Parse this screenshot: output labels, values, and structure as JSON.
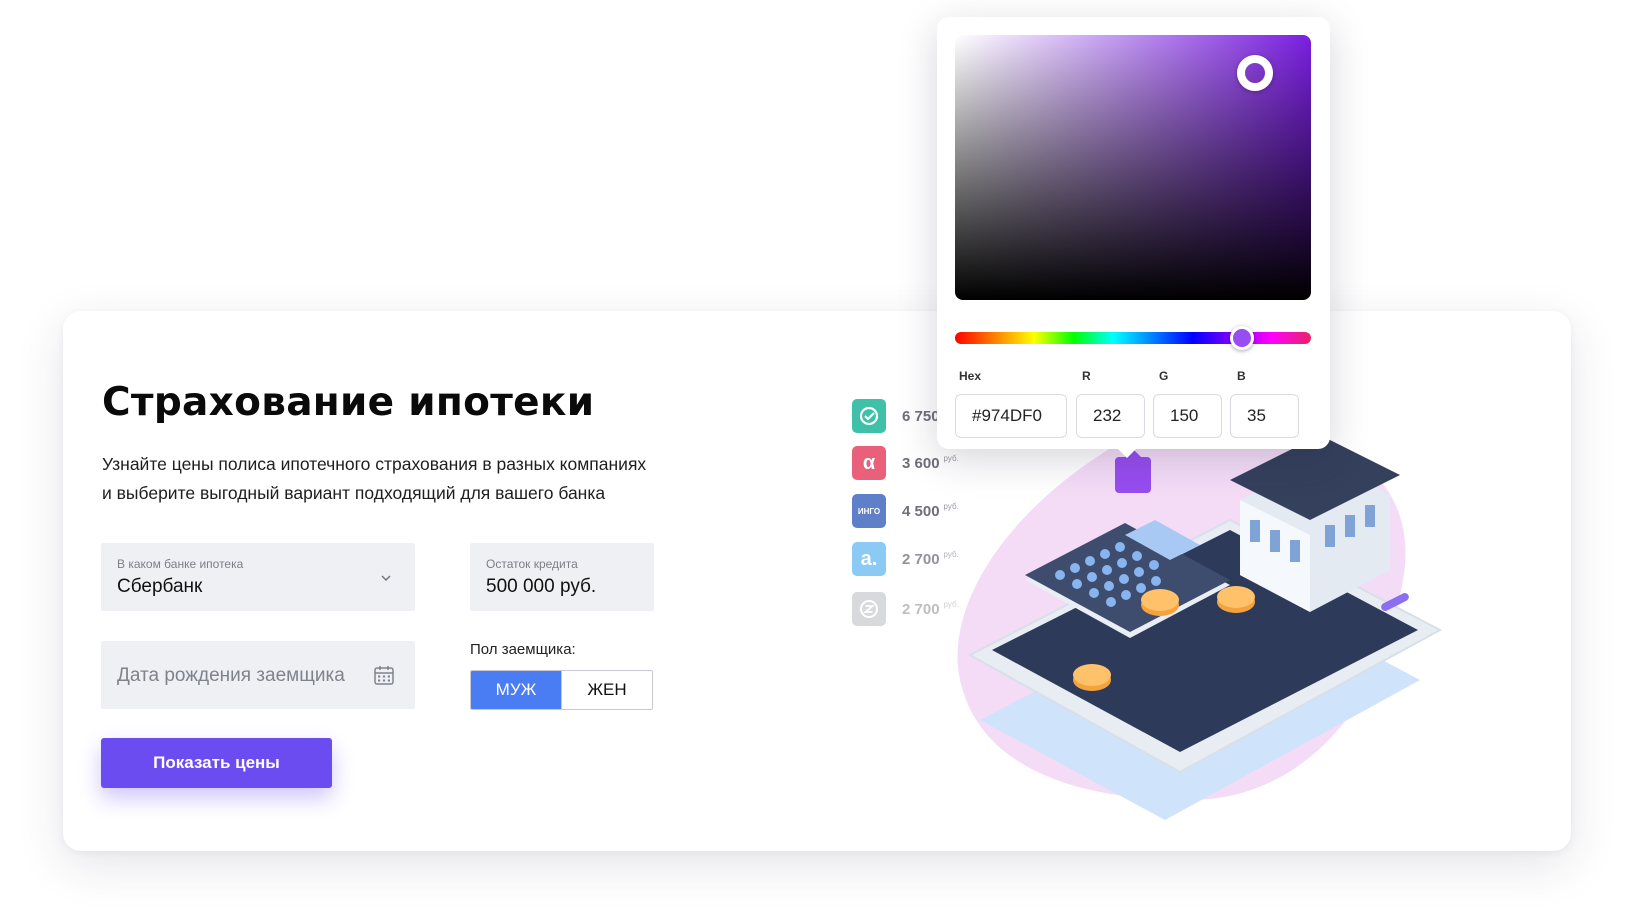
{
  "form": {
    "title": "Страхование ипотеки",
    "subtitle_line1": "Узнайте цены полиса ипотечного страхования в разных компаниях",
    "subtitle_line2": "и выберите выгодный вариант подходящий для вашего банка",
    "bank_label": "В каком банке ипотека",
    "bank_value": "Сбербанк",
    "remaining_label": "Остаток кредита",
    "remaining_value": "500 000 руб.",
    "birth_placeholder": "Дата рождения заемщика",
    "gender_label": "Пол заемщика:",
    "gender_male": "МУЖ",
    "gender_female": "ЖЕН",
    "submit_label": "Показать цены"
  },
  "insurers": [
    {
      "badge": "",
      "price": "6 750",
      "rub": "",
      "color": "#3ec1a8"
    },
    {
      "badge": "α",
      "price": "3 600",
      "rub": "руб.",
      "color": "#e8607a"
    },
    {
      "badge": "ИНГО",
      "price": "4 500",
      "rub": "руб.",
      "color": "#5f80c9"
    },
    {
      "badge": "a.",
      "price": "2 700",
      "rub": "руб.",
      "color": "#64b9f2"
    },
    {
      "badge": "",
      "price": "2 700",
      "rub": "руб.",
      "color": "#a7adb5"
    }
  ],
  "picker": {
    "hex_label": "Hex",
    "r_label": "R",
    "g_label": "G",
    "b_label": "B",
    "hex_value": "#974DF0",
    "r_value": "232",
    "g_value": "150",
    "b_value": "35",
    "selected_color": "#974df0"
  }
}
